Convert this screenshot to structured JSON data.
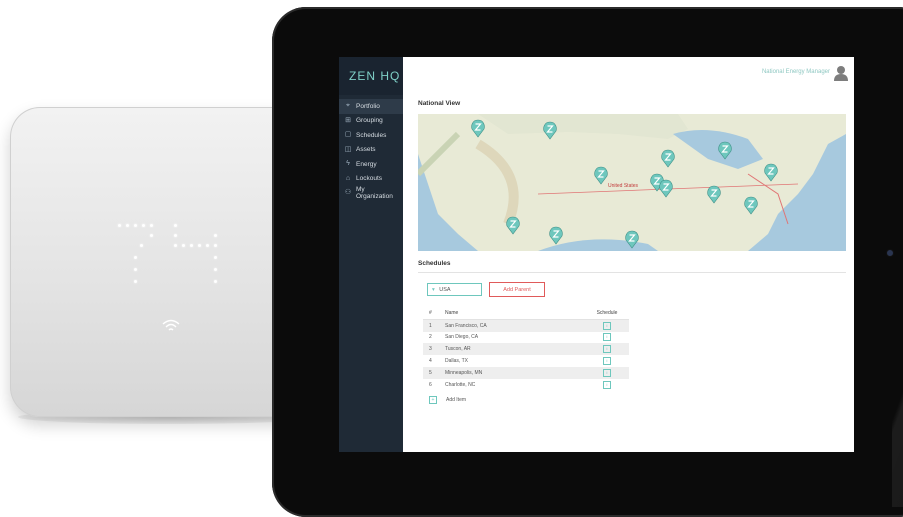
{
  "brand": {
    "name": "ZEN HQ"
  },
  "user": {
    "name": "National Energy Manager"
  },
  "nav": {
    "items": [
      {
        "label": "Portfolio",
        "icon": "location-pin-icon",
        "active": true
      },
      {
        "label": "Grouping",
        "icon": "grid-icon",
        "active": false
      },
      {
        "label": "Schedules",
        "icon": "calendar-icon",
        "active": false
      },
      {
        "label": "Assets",
        "icon": "asset-icon",
        "active": false
      },
      {
        "label": "Energy",
        "icon": "lightning-icon",
        "active": false
      },
      {
        "label": "Lockouts",
        "icon": "lock-icon",
        "active": false
      },
      {
        "label": "My Organization",
        "icon": "person-icon",
        "active": false
      }
    ]
  },
  "national_view": {
    "title": "National View",
    "map_label": "United States",
    "marker_icon": "zen-marker-icon"
  },
  "schedules": {
    "title": "Schedules",
    "country_select": "USA",
    "add_parent_label": "Add Parent",
    "columns": {
      "num": "#",
      "name": "Name",
      "schedule": "Schedule"
    },
    "rows": [
      {
        "num": "1",
        "name": "San Francisco, CA"
      },
      {
        "num": "2",
        "name": "San Diego, CA"
      },
      {
        "num": "3",
        "name": "Tuscon, AR"
      },
      {
        "num": "4",
        "name": "Dallas, TX"
      },
      {
        "num": "5",
        "name": "Minneapolis, MN"
      },
      {
        "num": "6",
        "name": "Charlotte, NC"
      }
    ],
    "add_item_label": "Add Item"
  },
  "colors": {
    "accent": "#6ec7bd",
    "add_parent": "#e05a5a",
    "sidebar": "#1f2a36"
  }
}
